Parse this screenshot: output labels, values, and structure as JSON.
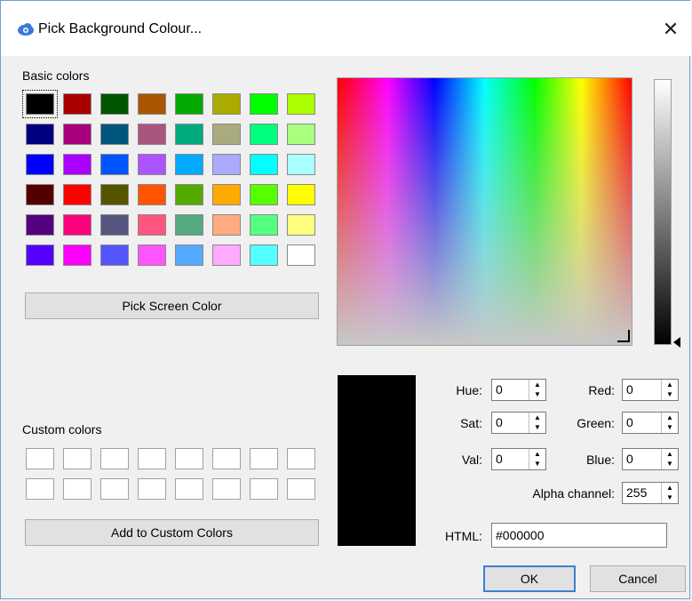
{
  "window": {
    "title": "Pick Background Colour...",
    "icon": "cloud-app-icon",
    "close_label": "✕"
  },
  "basic_colors": {
    "label": "Basic colors",
    "colors": [
      "#000000",
      "#aa0000",
      "#005500",
      "#aa5500",
      "#00aa00",
      "#aaaa00",
      "#00ff00",
      "#aaff00",
      "#00007f",
      "#aa007f",
      "#00557f",
      "#aa557f",
      "#00aa7f",
      "#aaaa7f",
      "#00ff7f",
      "#aaff7f",
      "#0000ff",
      "#aa00ff",
      "#0055ff",
      "#aa55ff",
      "#00aaff",
      "#aaaaff",
      "#00ffff",
      "#aaffff",
      "#550000",
      "#ff0000",
      "#555500",
      "#ff5500",
      "#55aa00",
      "#ffaa00",
      "#55ff00",
      "#ffff00",
      "#55007f",
      "#ff007f",
      "#55557f",
      "#ff557f",
      "#55aa7f",
      "#ffaa7f",
      "#55ff7f",
      "#ffff7f",
      "#5500ff",
      "#ff00ff",
      "#5555ff",
      "#ff55ff",
      "#55aaff",
      "#ffaaff",
      "#55ffff",
      "#ffffff"
    ],
    "selected_index": 0
  },
  "pick_screen_button": "Pick Screen Color",
  "custom_colors": {
    "label": "Custom colors",
    "count": 16
  },
  "add_custom_button": "Add to Custom Colors",
  "fields": {
    "hue": {
      "label": "Hue:",
      "value": "0"
    },
    "sat": {
      "label": "Sat:",
      "value": "0"
    },
    "val": {
      "label": "Val:",
      "value": "0"
    },
    "red": {
      "label": "Red:",
      "value": "0"
    },
    "green": {
      "label": "Green:",
      "value": "0"
    },
    "blue": {
      "label": "Blue:",
      "value": "0"
    },
    "alpha": {
      "label": "Alpha channel:",
      "value": "255"
    },
    "html": {
      "label": "HTML:",
      "value": "#000000"
    }
  },
  "preview_color": "#000000",
  "ok_button": "OK",
  "cancel_button": "Cancel"
}
